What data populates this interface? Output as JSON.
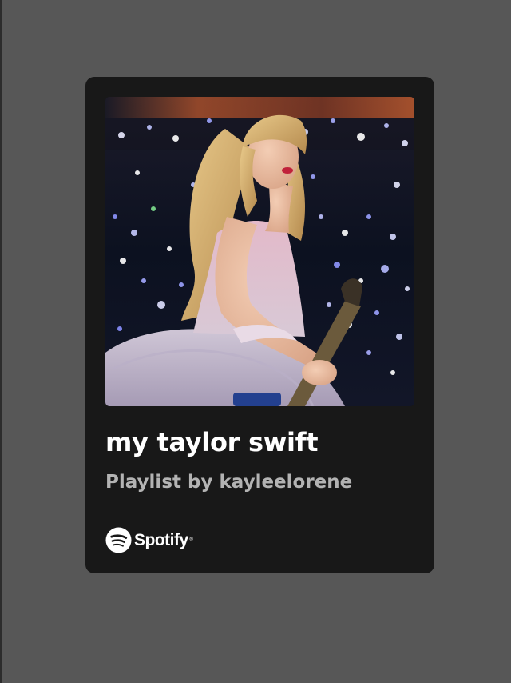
{
  "embed": {
    "title": "my taylor swift",
    "subtitle": "Playlist by kayleelorene",
    "brand": {
      "name": "Spotify",
      "trademark": "®",
      "icon": "spotify-logo-icon"
    }
  },
  "colors": {
    "page_background": "#575757",
    "card_background": "#181818",
    "title": "#ffffff",
    "subtitle": "#b3b3b3"
  }
}
